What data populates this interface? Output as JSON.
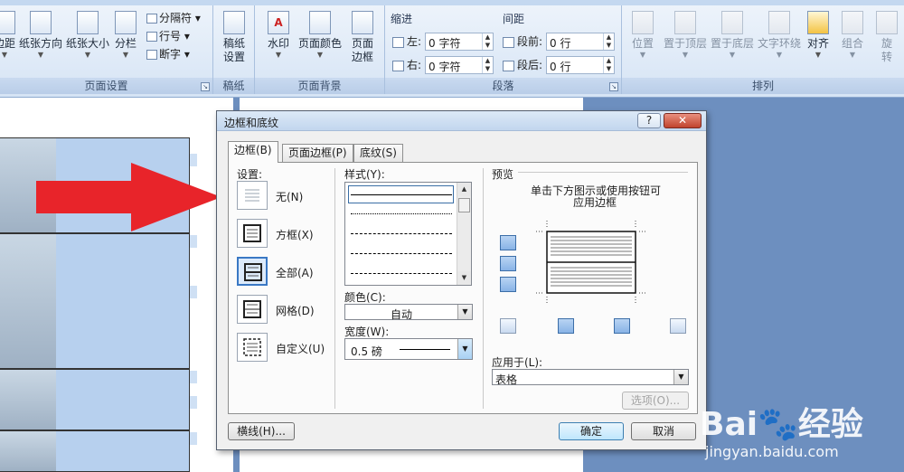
{
  "ribbon": {
    "page_setup": {
      "buttons": [
        {
          "label": "边距"
        },
        {
          "label": "纸张方向"
        },
        {
          "label": "纸张大小"
        },
        {
          "label": "分栏"
        }
      ],
      "small_items": [
        "分隔符",
        "行号",
        "断字"
      ],
      "caption": "页面设置"
    },
    "draft": {
      "button_line1": "稿纸",
      "button_line2": "设置",
      "caption": "稿纸"
    },
    "page_background": {
      "buttons": [
        {
          "label": "水印"
        },
        {
          "label": "页面颜色"
        },
        {
          "label_line1": "页面",
          "label_line2": "边框"
        }
      ],
      "caption": "页面背景"
    },
    "paragraph": {
      "indent_title": "缩进",
      "spacing_title": "间距",
      "left_label": "左:",
      "left_value": "0 字符",
      "right_label": "右:",
      "right_value": "0 字符",
      "before_label": "段前:",
      "before_value": "0 行",
      "after_label": "段后:",
      "after_value": "0 行",
      "caption": "段落"
    },
    "arrange": {
      "buttons": [
        {
          "label": "位置"
        },
        {
          "label": "置于顶层"
        },
        {
          "label": "置于底层"
        },
        {
          "label": "文字环绕"
        },
        {
          "label": "对齐"
        },
        {
          "label": "组合"
        },
        {
          "label_line1": "旋",
          "label_line2": "转"
        }
      ],
      "caption": "排列"
    }
  },
  "dialog": {
    "title": "边框和底纹",
    "help": "?",
    "close": "✕",
    "tabs": [
      "边框(B)",
      "页面边框(P)",
      "底纹(S)"
    ],
    "settings": {
      "title": "设置:",
      "items": [
        "无(N)",
        "方框(X)",
        "全部(A)",
        "网格(D)",
        "自定义(U)"
      ]
    },
    "style": {
      "title": "样式(Y):"
    },
    "color": {
      "title": "颜色(C):",
      "value": "自动"
    },
    "width": {
      "title": "宽度(W):",
      "value": "0.5 磅"
    },
    "preview": {
      "title": "预览",
      "hint_line1": "单击下方图示或使用按钮可",
      "hint_line2": "应用边框"
    },
    "apply_to": {
      "title": "应用于(L):",
      "value": "表格"
    },
    "options_button": "选项(O)...",
    "hline_button": "横线(H)...",
    "ok_button": "确定",
    "cancel_button": "取消"
  },
  "watermark": {
    "logo": "Bai🐾经验",
    "url": "jingyan.baidu.com"
  },
  "colors": {
    "arrow": "#e8242a",
    "accent": "#3a78c4"
  }
}
